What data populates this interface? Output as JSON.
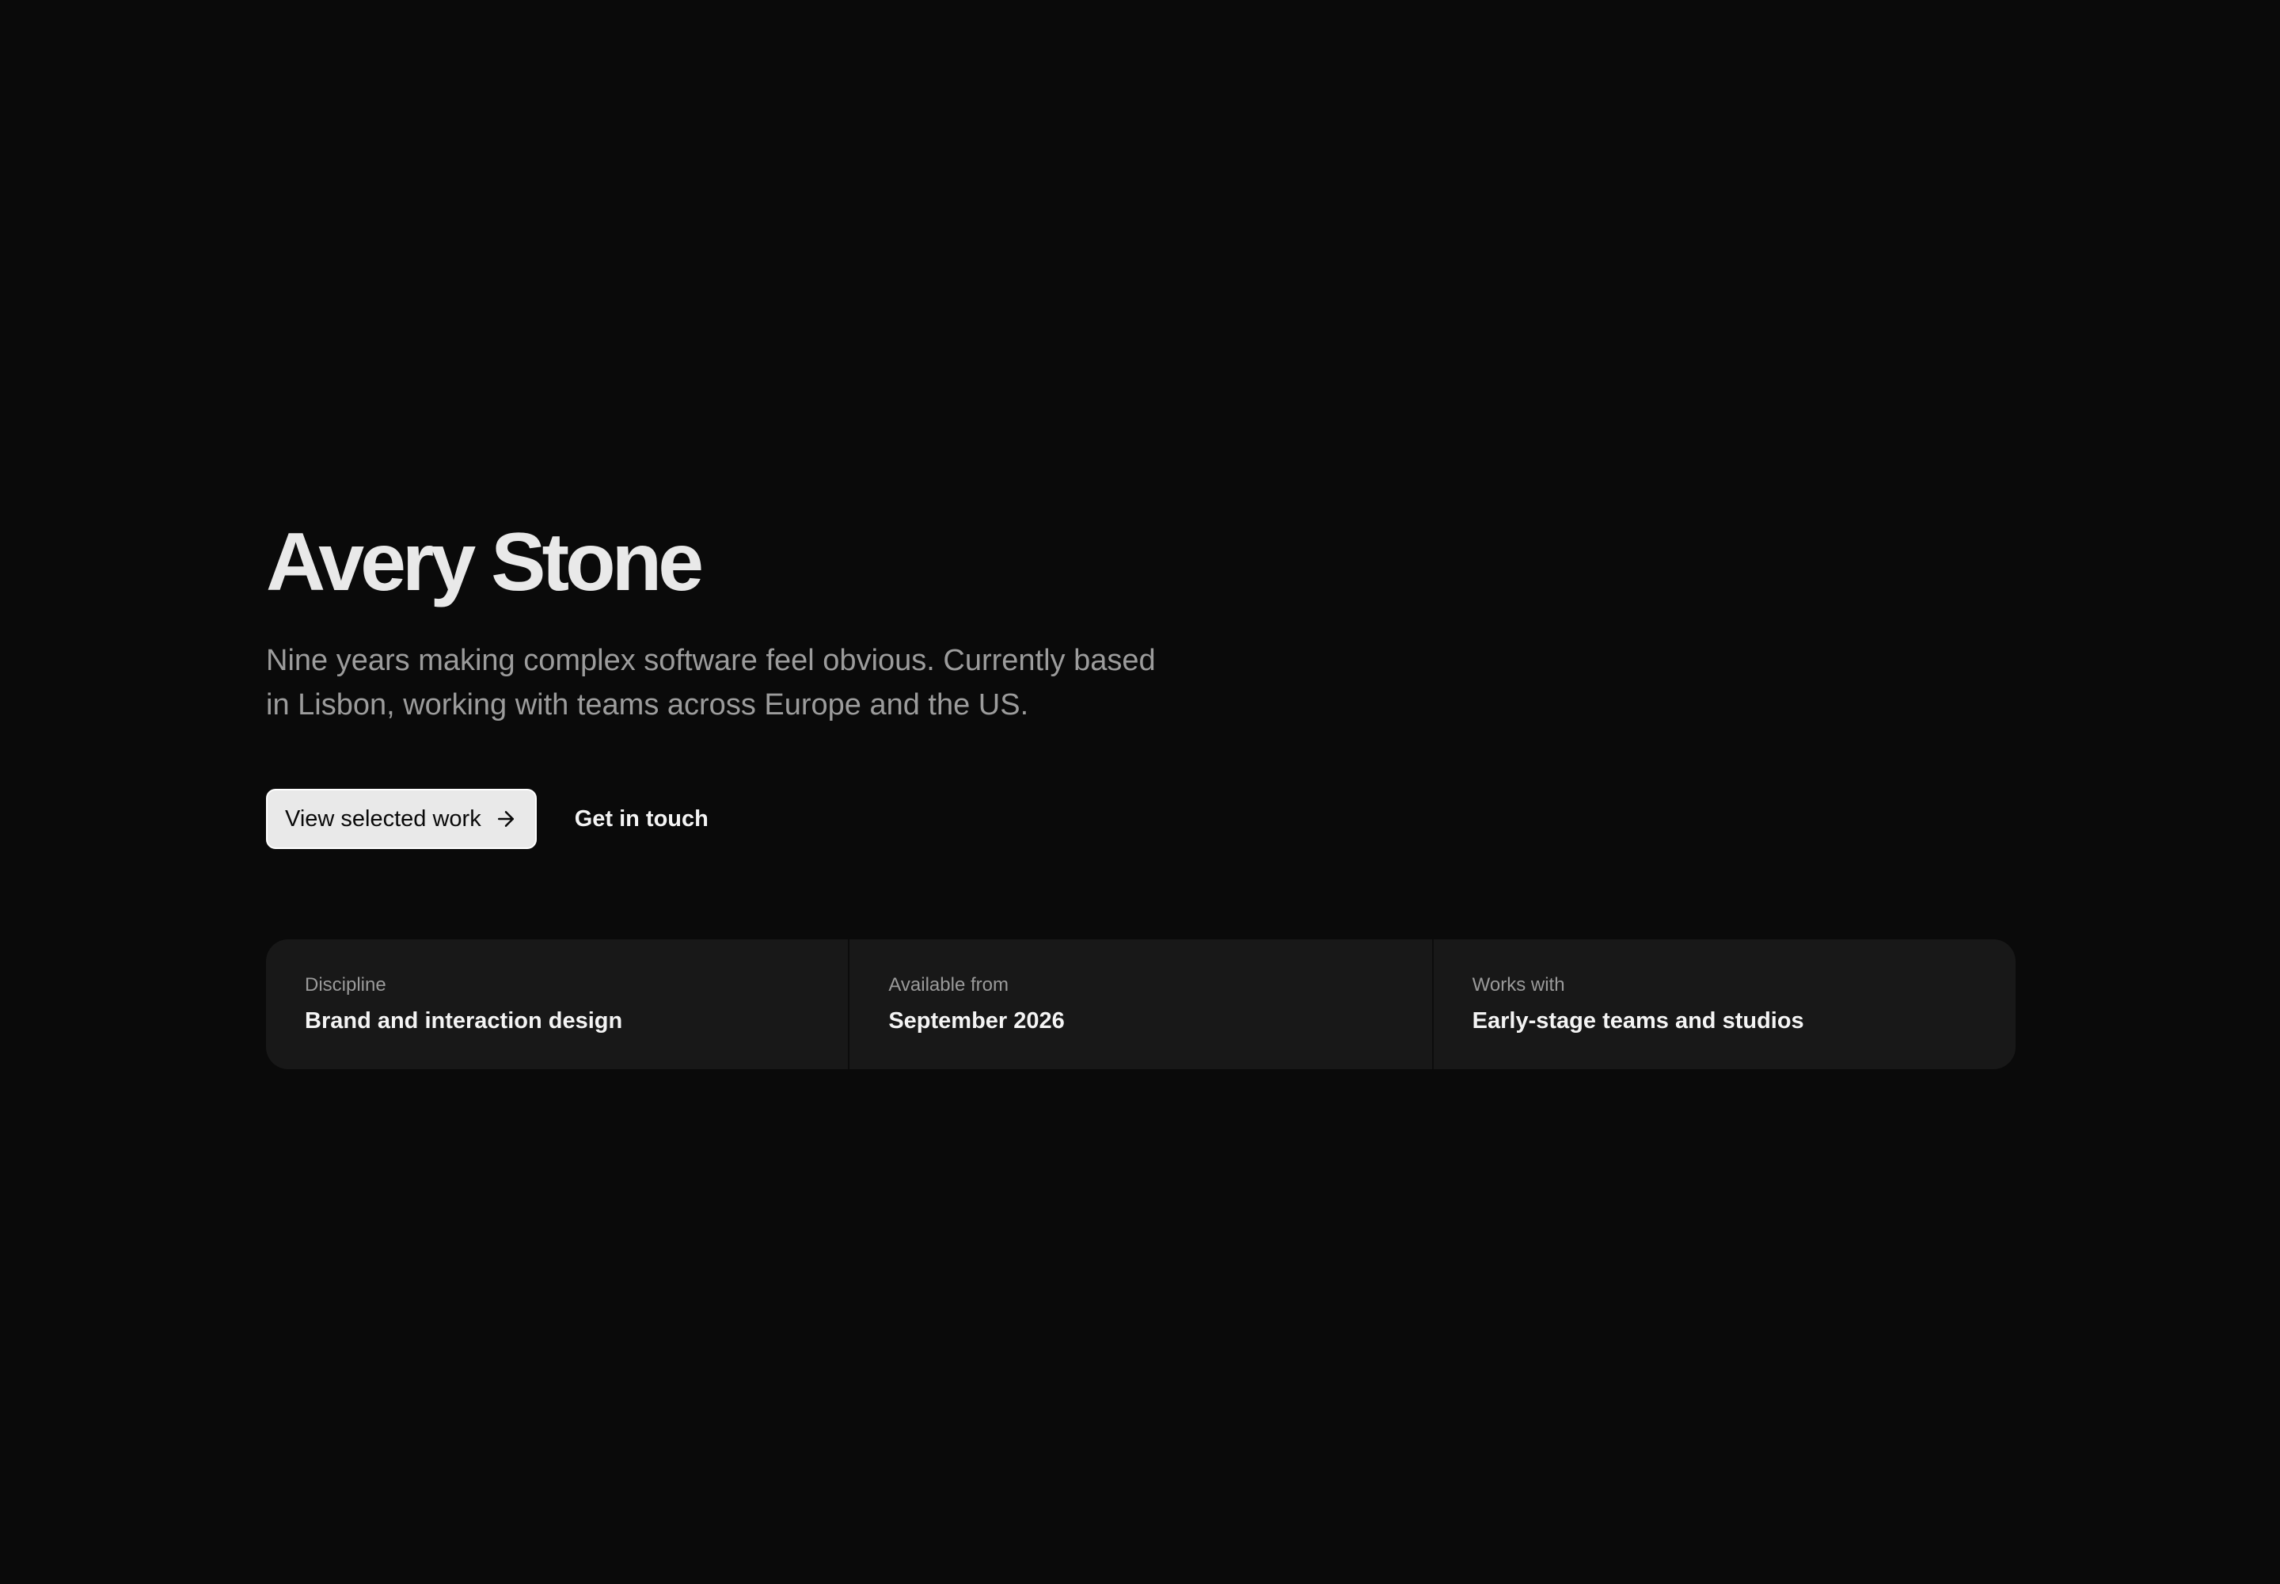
{
  "hero": {
    "name": "Avery Stone",
    "tagline_line1": "Nine years making complex software feel obvious. Currently based",
    "tagline_line2": "in Lisbon, working with teams across Europe and the US."
  },
  "actions": {
    "primary_label": "View selected work",
    "primary_icon": "arrow-right-icon",
    "secondary_label": "Get in touch"
  },
  "facts": [
    {
      "label": "Discipline",
      "value": "Brand and interaction design"
    },
    {
      "label": "Available from",
      "value": "September 2026"
    },
    {
      "label": "Works with",
      "value": "Early-stage teams and studios"
    }
  ],
  "colors": {
    "background": "#0a0a0a",
    "card": "#181818",
    "primary_button": "#e9e9e9",
    "heading": "#e9e9e9",
    "muted_text": "#9c9c9c"
  }
}
